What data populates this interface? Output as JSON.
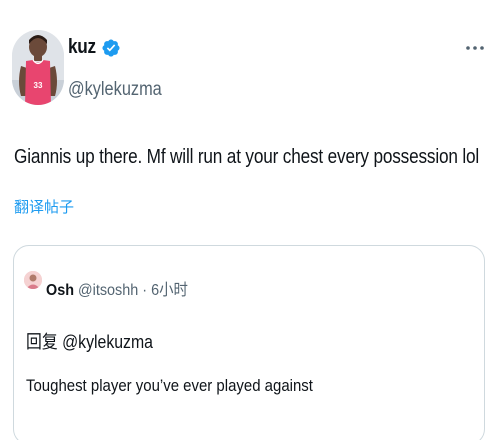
{
  "author": {
    "display_name": "kuz",
    "handle": "@kylekuzma",
    "verified": true
  },
  "tweet": {
    "text": "Giannis up there. Mf will run at your chest every possession  lol",
    "translate_label": "翻译帖子"
  },
  "quote": {
    "name": "Osh",
    "handle": "@itsoshh",
    "separator": "·",
    "time": "6小时",
    "reply_label": "回复 @kylekuzma",
    "text": "Toughest player you’ve ever played against"
  },
  "colors": {
    "accent": "#1d9bf0",
    "text": "#0f1419",
    "secondary": "#536471",
    "border": "#cfd9de",
    "jersey": "#e8456f"
  },
  "icons": [
    "verified-badge-icon",
    "more-options-icon"
  ]
}
